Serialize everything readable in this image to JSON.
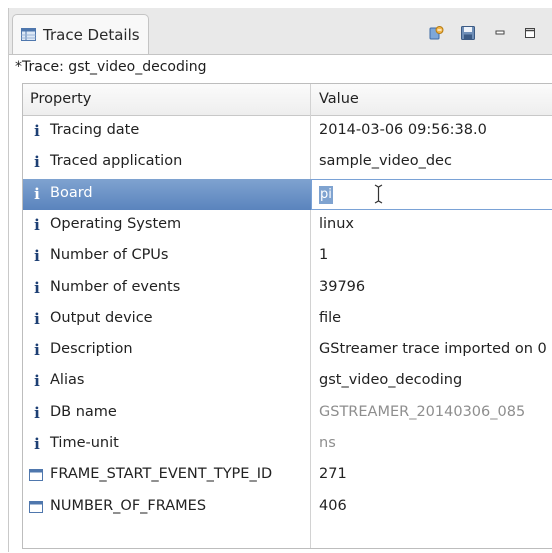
{
  "view": {
    "tab_label": "Trace Details",
    "trace_title": "*Trace: gst_video_decoding"
  },
  "table": {
    "columns": {
      "property": "Property",
      "value": "Value"
    },
    "rows": [
      {
        "icon": "info-icon",
        "property": "Tracing date",
        "value": "2014-03-06 09:56:38.0",
        "muted": false
      },
      {
        "icon": "info-icon",
        "property": "Traced application",
        "value": "sample_video_dec",
        "muted": false
      },
      {
        "icon": "info-icon",
        "property": "Board",
        "value": "pi",
        "muted": false,
        "selected": true,
        "editing": true
      },
      {
        "icon": "info-icon",
        "property": "Operating System",
        "value": "linux",
        "muted": false
      },
      {
        "icon": "info-icon",
        "property": "Number of CPUs",
        "value": "1",
        "muted": false
      },
      {
        "icon": "info-icon",
        "property": "Number of events",
        "value": "39796",
        "muted": false
      },
      {
        "icon": "info-icon",
        "property": "Output device",
        "value": "file",
        "muted": false
      },
      {
        "icon": "info-icon",
        "property": "Description",
        "value": "GStreamer trace imported on 0",
        "muted": false
      },
      {
        "icon": "info-icon",
        "property": "Alias",
        "value": "gst_video_decoding",
        "muted": false
      },
      {
        "icon": "info-icon",
        "property": "DB name",
        "value": "GSTREAMER_20140306_085",
        "muted": true
      },
      {
        "icon": "info-icon",
        "property": "Time-unit",
        "value": "ns",
        "muted": true
      },
      {
        "icon": "table-icon",
        "property": "FRAME_START_EVENT_TYPE_ID",
        "value": "271",
        "muted": false
      },
      {
        "icon": "table-icon",
        "property": "NUMBER_OF_FRAMES",
        "value": "406",
        "muted": false
      }
    ]
  },
  "toolbar": {
    "buttons": [
      "refresh-icon",
      "save-icon",
      "minimize-icon",
      "maximize-icon"
    ]
  },
  "colors": {
    "selection": "#5a84bd",
    "info_icon": "#1d3f74"
  }
}
